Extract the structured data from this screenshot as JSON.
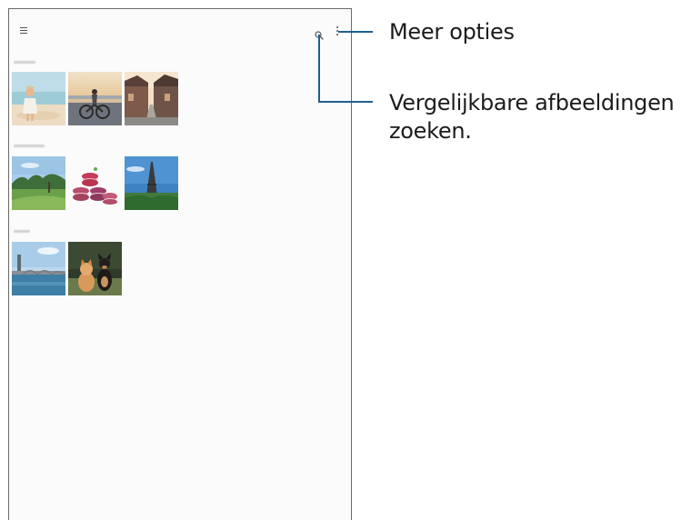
{
  "callouts": {
    "more_options": "Meer opties",
    "similar_images_line1": "Vergelijkbare afbeeldingen",
    "similar_images_line2": "zoeken."
  },
  "icons": {
    "menu": "hamburger-menu-icon",
    "search": "search-icon",
    "more": "more-options-icon"
  },
  "photo_groups": [
    {
      "photos": [
        "girl-on-beach",
        "cyclist-at-sunset",
        "village-street"
      ]
    },
    {
      "photos": [
        "golf-course",
        "macarons",
        "eiffel-tower"
      ]
    },
    {
      "photos": [
        "bridge-and-river",
        "cat-and-dog"
      ]
    }
  ],
  "colors": {
    "callout_line": "#1f5f8f",
    "device_border": "#6b6b6b"
  }
}
